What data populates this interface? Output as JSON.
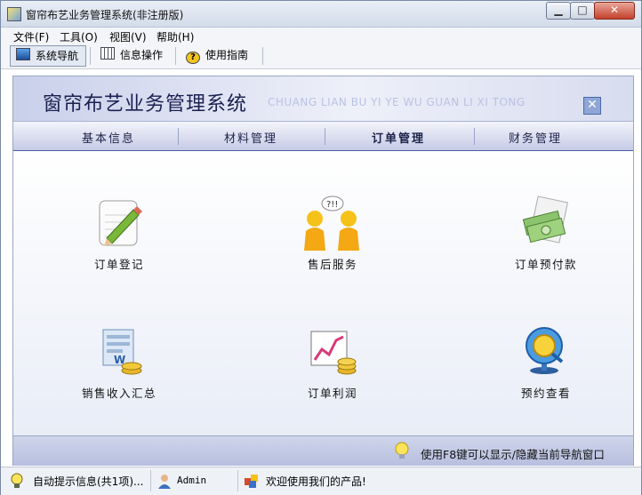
{
  "window": {
    "title": "窗帘布艺业务管理系统(非注册版)"
  },
  "menu": [
    {
      "label": "文件(F)"
    },
    {
      "label": "工具(O)"
    },
    {
      "label": "视图(V)"
    },
    {
      "label": "帮助(H)"
    }
  ],
  "toolbar": [
    {
      "label": "系统导航",
      "icon": "monitor-icon",
      "active": true
    },
    {
      "label": "信息操作",
      "icon": "grid-icon"
    },
    {
      "label": "使用指南",
      "icon": "question-icon"
    }
  ],
  "banner": {
    "title": "窗帘布艺业务管理系统",
    "subtitle": "CHUANG LIAN BU YI YE WU GUAN LI XI TONG"
  },
  "tabs": [
    {
      "label": "基本信息"
    },
    {
      "label": "材料管理"
    },
    {
      "label": "订单管理",
      "active": true
    },
    {
      "label": "财务管理"
    }
  ],
  "items": [
    {
      "label": "订单登记",
      "icon": "notepad-pencil-icon"
    },
    {
      "label": "售后服务",
      "icon": "people-chat-icon"
    },
    {
      "label": "订单预付款",
      "icon": "money-document-icon"
    },
    {
      "label": "销售收入汇总",
      "icon": "income-summary-icon"
    },
    {
      "label": "订单利润",
      "icon": "profit-chart-icon"
    },
    {
      "label": "预约查看",
      "icon": "magnifier-globe-icon"
    }
  ],
  "status_tip": "使用F8键可以显示/隐藏当前导航窗口",
  "statusbar": {
    "tips": "自动提示信息(共1项)...",
    "user": "Admin",
    "welcome": "欢迎使用我们的产品!"
  },
  "colors": {
    "accent": "#4b5aa8",
    "banner": "#c9d0ea",
    "panel": "#e8ebf4"
  }
}
